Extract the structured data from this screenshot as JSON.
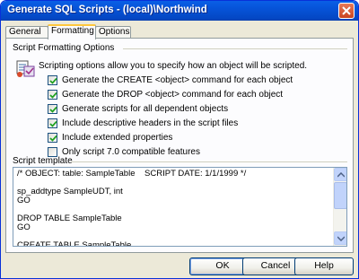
{
  "window": {
    "title": "Generate SQL Scripts - (local)\\Northwind"
  },
  "tabs": [
    {
      "label": "General"
    },
    {
      "label": "Formatting"
    },
    {
      "label": "Options"
    }
  ],
  "formatting": {
    "group_label": "Script Formatting Options",
    "description": "Scripting options allow you to specify how an object will be scripted.",
    "options": [
      {
        "label": "Generate the CREATE <object> command for each object",
        "checked": true
      },
      {
        "label": "Generate the DROP <object> command for each object",
        "checked": true
      },
      {
        "label": "Generate scripts for all dependent objects",
        "checked": true
      },
      {
        "label": "Include descriptive headers in the script files",
        "checked": true
      },
      {
        "label": "Include extended properties",
        "checked": true
      },
      {
        "label": "Only script 7.0 compatible features",
        "checked": false
      }
    ],
    "template_label": "Script template",
    "template_text": "/* OBJECT: table: SampleTable    SCRIPT DATE: 1/1/1999 */\n\nsp_addtype SampleUDT, int\nGO\n\nDROP TABLE SampleTable\nGO\n\nCREATE TABLE SampleTable"
  },
  "buttons": {
    "ok": "OK",
    "cancel": "Cancel",
    "help": "Help"
  },
  "icons": {
    "close": "close-icon",
    "options": "scripting-options-icon"
  }
}
